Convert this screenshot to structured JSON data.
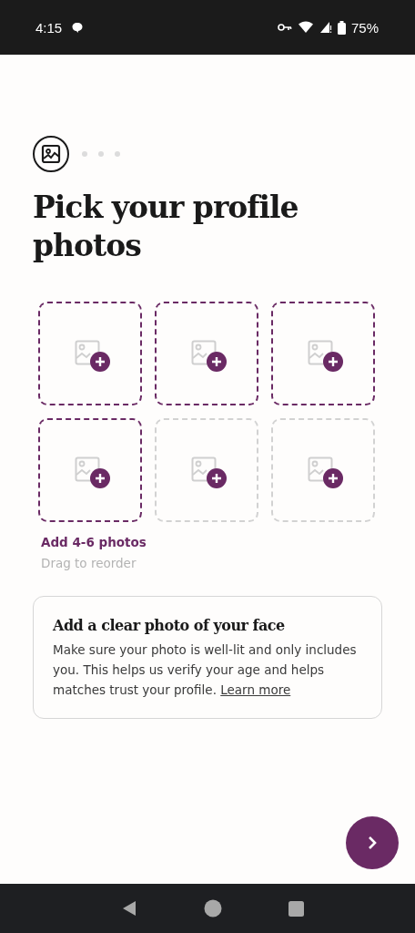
{
  "status_bar": {
    "time": "4:15",
    "battery": "75%"
  },
  "title": "Pick your profile photos",
  "slots": [
    {
      "required": true
    },
    {
      "required": true
    },
    {
      "required": true
    },
    {
      "required": true
    },
    {
      "required": false
    },
    {
      "required": false
    }
  ],
  "hint": "Add 4-6 photos",
  "subhint": "Drag to reorder",
  "tip_card": {
    "title": "Add a clear photo of your face",
    "body": "Make sure your photo is well-lit and only includes you. This helps us verify your age and helps matches trust your profile.",
    "link": "Learn more"
  }
}
